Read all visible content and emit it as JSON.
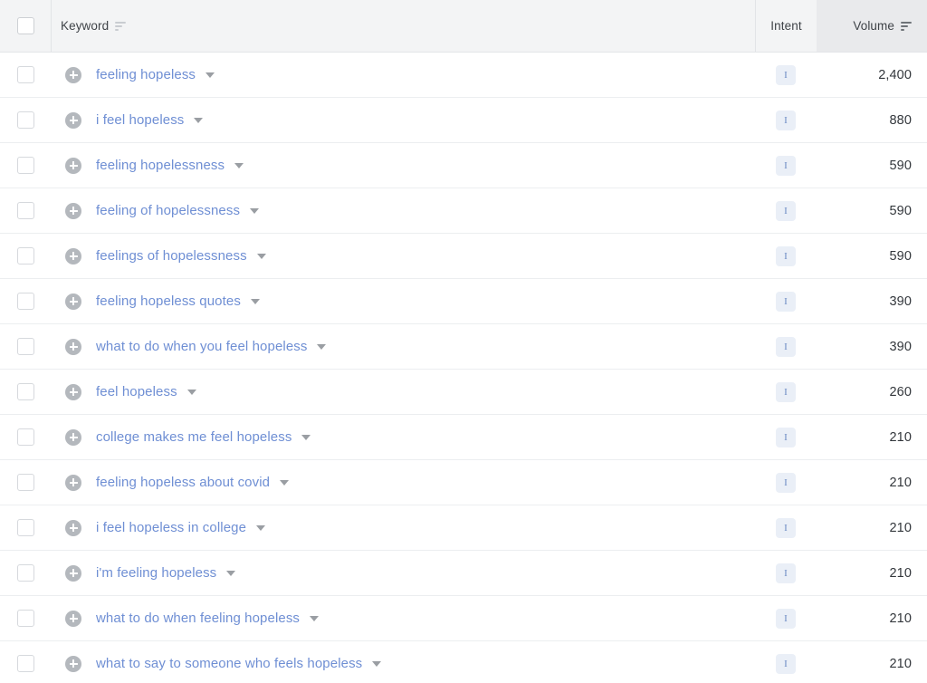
{
  "table": {
    "columns": {
      "select_all": "",
      "keyword": "Keyword",
      "intent": "Intent",
      "volume": "Volume"
    },
    "sort": {
      "keyword_icon": "sort-icon",
      "volume_icon": "sort-icon-active",
      "active_column": "Volume"
    },
    "row_icons": {
      "add": "plus-circle-icon",
      "expand": "chevron-down-icon",
      "checkbox": "checkbox-icon"
    },
    "colors": {
      "keyword_link": "#6f8fd4",
      "header_bg": "#f3f4f5",
      "volume_header_bg": "#e9eaec",
      "intent_badge_bg": "#eaeff7",
      "intent_badge_text": "#6b8ac4",
      "plus_icon": "#b4b8bd",
      "row_border": "#eceef0"
    },
    "rows": [
      {
        "keyword": "feeling hopeless",
        "intent": "I",
        "volume": "2,400"
      },
      {
        "keyword": "i feel hopeless",
        "intent": "I",
        "volume": "880"
      },
      {
        "keyword": "feeling hopelessness",
        "intent": "I",
        "volume": "590"
      },
      {
        "keyword": "feeling of hopelessness",
        "intent": "I",
        "volume": "590"
      },
      {
        "keyword": "feelings of hopelessness",
        "intent": "I",
        "volume": "590"
      },
      {
        "keyword": "feeling hopeless quotes",
        "intent": "I",
        "volume": "390"
      },
      {
        "keyword": "what to do when you feel hopeless",
        "intent": "I",
        "volume": "390"
      },
      {
        "keyword": "feel hopeless",
        "intent": "I",
        "volume": "260"
      },
      {
        "keyword": "college makes me feel hopeless",
        "intent": "I",
        "volume": "210"
      },
      {
        "keyword": "feeling hopeless about covid",
        "intent": "I",
        "volume": "210"
      },
      {
        "keyword": "i feel hopeless in college",
        "intent": "I",
        "volume": "210"
      },
      {
        "keyword": "i'm feeling hopeless",
        "intent": "I",
        "volume": "210"
      },
      {
        "keyword": "what to do when feeling hopeless",
        "intent": "I",
        "volume": "210"
      },
      {
        "keyword": "what to say to someone who feels hopeless",
        "intent": "I",
        "volume": "210"
      }
    ]
  }
}
